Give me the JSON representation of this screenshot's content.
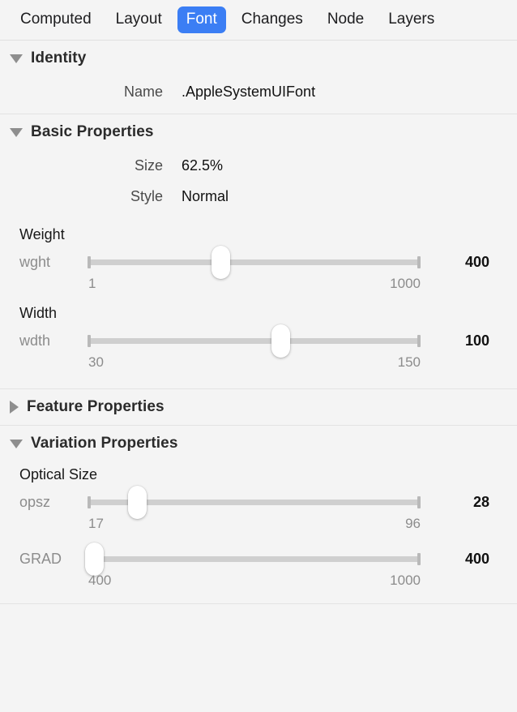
{
  "tabs": [
    {
      "label": "Computed",
      "selected": false
    },
    {
      "label": "Layout",
      "selected": false
    },
    {
      "label": "Font",
      "selected": true
    },
    {
      "label": "Changes",
      "selected": false
    },
    {
      "label": "Node",
      "selected": false
    },
    {
      "label": "Layers",
      "selected": false
    }
  ],
  "accent_color": "#3b7ef4",
  "sections": {
    "identity": {
      "title": "Identity",
      "expanded": true,
      "rows": [
        {
          "key": "Name",
          "value": ".AppleSystemUIFont"
        }
      ]
    },
    "basic": {
      "title": "Basic Properties",
      "expanded": true,
      "rows": [
        {
          "key": "Size",
          "value": "62.5%"
        },
        {
          "key": "Style",
          "value": "Normal"
        }
      ],
      "sliders": [
        {
          "group_title": "Weight",
          "axis": "wght",
          "value": "400",
          "min": "1",
          "max": "1000",
          "thumb_pct": 40
        },
        {
          "group_title": "Width",
          "axis": "wdth",
          "value": "100",
          "min": "30",
          "max": "150",
          "thumb_pct": 58
        }
      ]
    },
    "feature": {
      "title": "Feature Properties",
      "expanded": false
    },
    "variation": {
      "title": "Variation Properties",
      "expanded": true,
      "sliders": [
        {
          "group_title": "Optical Size",
          "axis": "opsz",
          "value": "28",
          "min": "17",
          "max": "96",
          "thumb_pct": 15
        },
        {
          "group_title": "",
          "axis": "GRAD",
          "value": "400",
          "min": "400",
          "max": "1000",
          "thumb_pct": 2
        }
      ]
    }
  }
}
